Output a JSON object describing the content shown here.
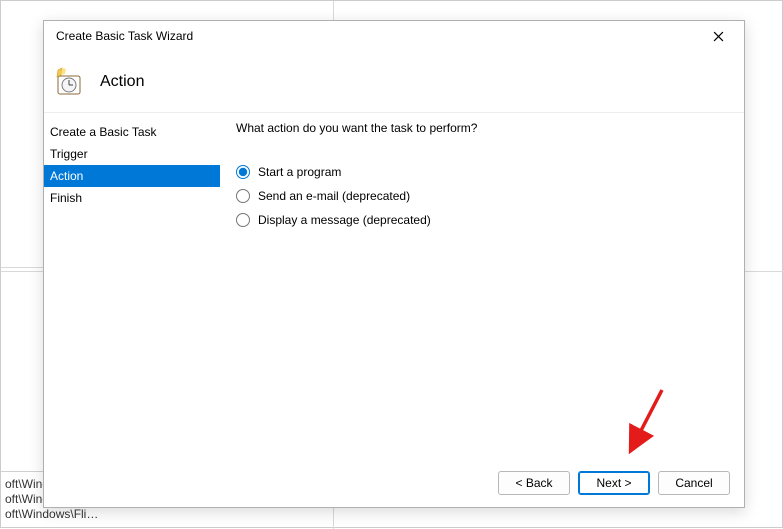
{
  "bg_fragments": [
    "oft\\Wind…",
    "oft\\Windows\\U…",
    "oft\\Windows\\Fli…"
  ],
  "dialog": {
    "title": "Create Basic Task Wizard",
    "header": "Action"
  },
  "sidebar": {
    "items": [
      {
        "label": "Create a Basic Task",
        "selected": false
      },
      {
        "label": "Trigger",
        "selected": false
      },
      {
        "label": "Action",
        "selected": true
      },
      {
        "label": "Finish",
        "selected": false
      }
    ]
  },
  "content": {
    "prompt": "What action do you want the task to perform?",
    "options": [
      {
        "label": "Start a program",
        "checked": true
      },
      {
        "label": "Send an e-mail (deprecated)",
        "checked": false
      },
      {
        "label": "Display a message (deprecated)",
        "checked": false
      }
    ]
  },
  "footer": {
    "back": "< Back",
    "next": "Next >",
    "cancel": "Cancel"
  }
}
